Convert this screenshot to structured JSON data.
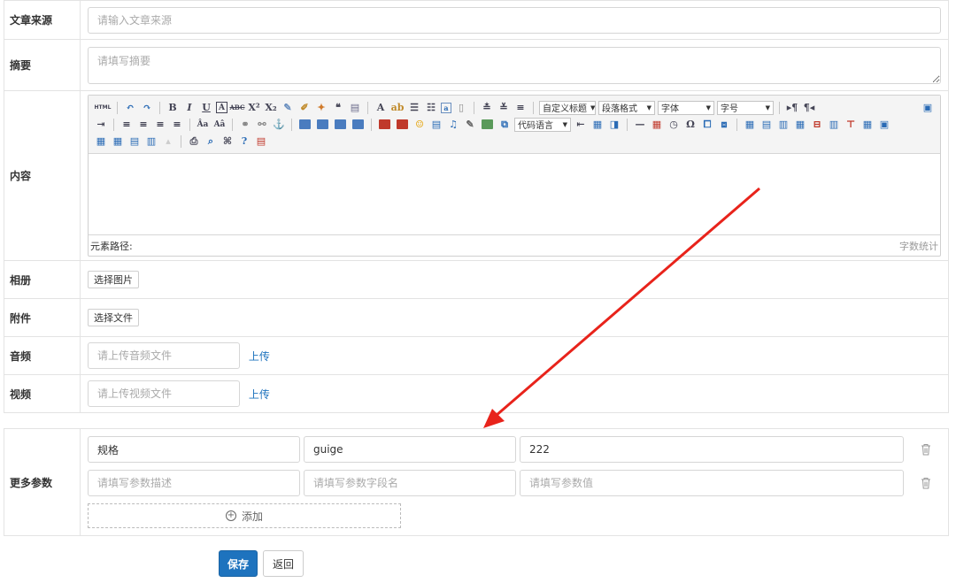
{
  "source": {
    "label": "文章来源",
    "placeholder": "请输入文章来源"
  },
  "summary": {
    "label": "摘要",
    "placeholder": "请填写摘要"
  },
  "content": {
    "label": "内容",
    "selects": {
      "custom_title": "自定义标题",
      "paragraph": "段落格式",
      "font": "字体",
      "size": "字号",
      "code_lang": "代码语言"
    },
    "status_path": "元素路径:",
    "status_count": "字数统计"
  },
  "album": {
    "label": "相册",
    "button": "选择图片"
  },
  "attachment": {
    "label": "附件",
    "button": "选择文件"
  },
  "audio": {
    "label": "音频",
    "placeholder": "请上传音频文件",
    "upload": "上传"
  },
  "video": {
    "label": "视频",
    "placeholder": "请上传视频文件",
    "upload": "上传"
  },
  "params": {
    "label": "更多参数",
    "rows": [
      {
        "desc": "规格",
        "field": "guige",
        "value": "222"
      },
      {
        "desc": "",
        "field": "",
        "value": ""
      }
    ],
    "placeholders": {
      "desc": "请填写参数描述",
      "field": "请填写参数字段名",
      "value": "请填写参数值"
    },
    "add": "添加"
  },
  "actions": {
    "save": "保存",
    "back": "返回"
  },
  "colors": {
    "primary": "#1e73be",
    "annotation_arrow": "#e8231b"
  }
}
